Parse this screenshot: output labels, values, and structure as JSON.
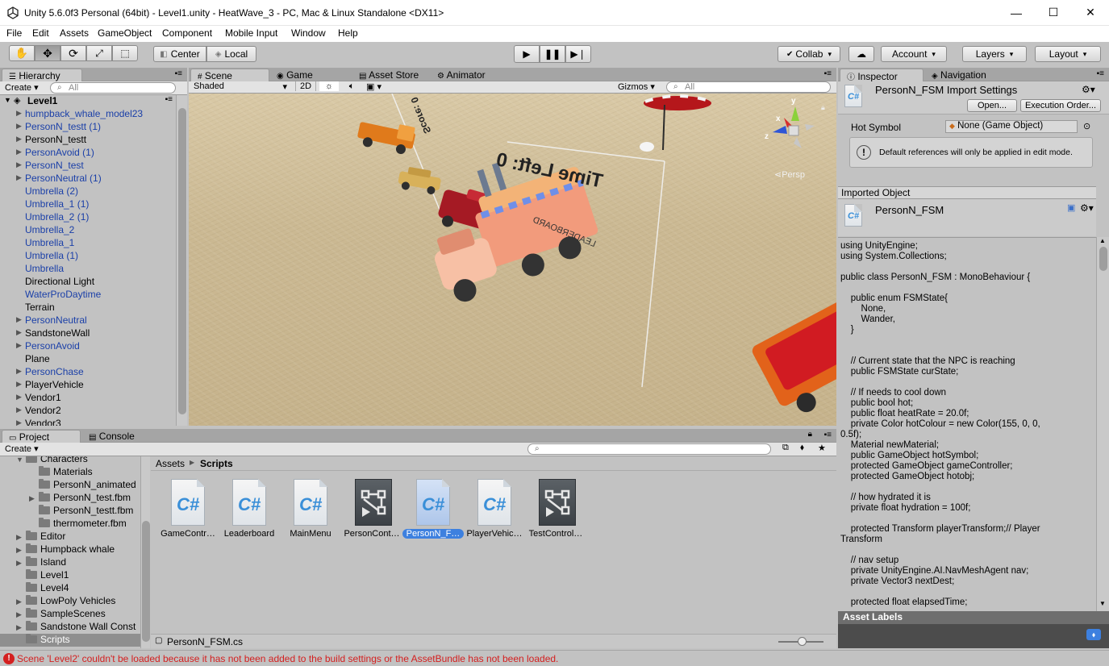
{
  "window": {
    "title": "Unity 5.6.0f3 Personal (64bit) - Level1.unity - HeatWave_3 - PC, Mac & Linux Standalone <DX11>",
    "minimize": "—",
    "maximize": "☐",
    "close": "✕"
  },
  "menu": [
    "File",
    "Edit",
    "Assets",
    "GameObject",
    "Component",
    "Mobile Input",
    "Window",
    "Help"
  ],
  "toolbar": {
    "pivot": "Center",
    "space": "Local",
    "collab": "Collab",
    "account": "Account",
    "layers": "Layers",
    "layout": "Layout"
  },
  "hierarchy": {
    "tab": "Hierarchy",
    "create": "Create",
    "search_placeholder": "All",
    "scene": "Level1",
    "items": [
      {
        "label": "humpback_whale_model23",
        "blue": true,
        "arrow": true
      },
      {
        "label": "PersonN_testt (1)",
        "blue": true,
        "arrow": true
      },
      {
        "label": "PersonN_testt",
        "blue": false,
        "arrow": true
      },
      {
        "label": "PersonAvoid (1)",
        "blue": true,
        "arrow": true
      },
      {
        "label": "PersonN_test",
        "blue": true,
        "arrow": true
      },
      {
        "label": "PersonNeutral (1)",
        "blue": true,
        "arrow": true
      },
      {
        "label": "Umbrella (2)",
        "blue": true,
        "arrow": false
      },
      {
        "label": "Umbrella_1 (1)",
        "blue": true,
        "arrow": false
      },
      {
        "label": "Umbrella_2 (1)",
        "blue": true,
        "arrow": false
      },
      {
        "label": "Umbrella_2",
        "blue": true,
        "arrow": false
      },
      {
        "label": "Umbrella_1",
        "blue": true,
        "arrow": false
      },
      {
        "label": "Umbrella (1)",
        "blue": true,
        "arrow": false
      },
      {
        "label": "Umbrella",
        "blue": true,
        "arrow": false
      },
      {
        "label": "Directional Light",
        "blue": false,
        "arrow": false
      },
      {
        "label": "WaterProDaytime",
        "blue": true,
        "arrow": false
      },
      {
        "label": "Terrain",
        "blue": false,
        "arrow": false
      },
      {
        "label": "PersonNeutral",
        "blue": true,
        "arrow": true
      },
      {
        "label": "SandstoneWall",
        "blue": false,
        "arrow": true
      },
      {
        "label": "PersonAvoid",
        "blue": true,
        "arrow": true
      },
      {
        "label": "Plane",
        "blue": false,
        "arrow": false
      },
      {
        "label": "PersonChase",
        "blue": true,
        "arrow": true
      },
      {
        "label": "PlayerVehicle",
        "blue": false,
        "arrow": true
      },
      {
        "label": "Vendor1",
        "blue": false,
        "arrow": true
      },
      {
        "label": "Vendor2",
        "blue": false,
        "arrow": true
      },
      {
        "label": "Vendor3",
        "blue": false,
        "arrow": true
      }
    ]
  },
  "scene": {
    "tabs": {
      "scene": "Scene",
      "game": "Game",
      "asset_store": "Asset Store",
      "animator": "Animator"
    },
    "shading": "Shaded",
    "mode_2d": "2D",
    "gizmos": "Gizmos",
    "search_placeholder": "All",
    "persp": "Persp",
    "world_text": {
      "time_left": "Time Left: 0",
      "score": "Score: 0",
      "leaderboard": "LEADERBOARD"
    },
    "axis": {
      "x": "x",
      "y": "y",
      "z": "z"
    }
  },
  "inspector": {
    "tabs": {
      "inspector": "Inspector",
      "navigation": "Navigation"
    },
    "title": "PersonN_FSM Import Settings",
    "open": "Open...",
    "execution_order": "Execution Order...",
    "hot_symbol_label": "Hot Symbol",
    "hot_symbol_value": "None (Game Object)",
    "info": "Default references will only be applied in edit mode.",
    "imported_object_header": "Imported Object",
    "imported_name": "PersonN_FSM",
    "code": "using UnityEngine;\nusing System.Collections;\n\npublic class PersonN_FSM : MonoBehaviour {\n\n    public enum FSMState{\n        None,\n        Wander,\n    }\n\n\n    // Current state that the NPC is reaching\n    public FSMState curState;\n\n    // If needs to cool down\n    public bool hot;\n    public float heatRate = 20.0f;\n    private Color hotColour = new Color(155, 0, 0,\n0.5f);\n    Material newMaterial;\n    public GameObject hotSymbol;\n    protected GameObject gameController;\n    protected GameObject hotobj;\n\n    // how hydrated it is\n    private float hydration = 100f;\n\n    protected Transform playerTransform;// Player\nTransform\n\n    // nav setup\n    private UnityEngine.AI.NavMeshAgent nav;\n    private Vector3 nextDest;\n\n    protected float elapsedTime;",
    "asset_labels": "Asset Labels"
  },
  "project": {
    "tabs": {
      "project": "Project",
      "console": "Console"
    },
    "create": "Create",
    "breadcrumb": {
      "root": "Assets",
      "current": "Scripts"
    },
    "tree": [
      {
        "label": "Characters",
        "indent": 0,
        "arrow": "▼"
      },
      {
        "label": "Materials",
        "indent": 1,
        "arrow": ""
      },
      {
        "label": "PersonN_animated",
        "indent": 1,
        "arrow": ""
      },
      {
        "label": "PersonN_test.fbm",
        "indent": 1,
        "arrow": "▶"
      },
      {
        "label": "PersonN_testt.fbm",
        "indent": 1,
        "arrow": ""
      },
      {
        "label": "thermometer.fbm",
        "indent": 1,
        "arrow": ""
      },
      {
        "label": "Editor",
        "indent": 0,
        "arrow": "▶"
      },
      {
        "label": "Humpback whale",
        "indent": 0,
        "arrow": "▶"
      },
      {
        "label": "Island",
        "indent": 0,
        "arrow": "▶"
      },
      {
        "label": "Level1",
        "indent": 0,
        "arrow": ""
      },
      {
        "label": "Level4",
        "indent": 0,
        "arrow": ""
      },
      {
        "label": "LowPoly Vehicles",
        "indent": 0,
        "arrow": "▶"
      },
      {
        "label": "SampleScenes",
        "indent": 0,
        "arrow": "▶"
      },
      {
        "label": "Sandstone Wall Const",
        "indent": 0,
        "arrow": "▶"
      },
      {
        "label": "Scripts",
        "indent": 0,
        "arrow": ""
      }
    ],
    "assets": [
      {
        "name": "GameContr…",
        "kind": "cs",
        "selected": false
      },
      {
        "name": "Leaderboard",
        "kind": "cs",
        "selected": false
      },
      {
        "name": "MainMenu",
        "kind": "cs",
        "selected": false
      },
      {
        "name": "PersonCont…",
        "kind": "controller",
        "selected": false
      },
      {
        "name": "PersonN_F…",
        "kind": "cs",
        "selected": true
      },
      {
        "name": "PlayerVehic…",
        "kind": "cs",
        "selected": false
      },
      {
        "name": "TestControl…",
        "kind": "controller",
        "selected": false
      }
    ],
    "selected_file": "PersonN_FSM.cs"
  },
  "status": {
    "message": "Scene 'Level2' couldn't be loaded because it has not been added to the build settings or the AssetBundle has not been loaded."
  },
  "colors": {
    "accent": "#3d80df",
    "error": "#d42020",
    "hierarchy_blue": "#1a3fa8"
  }
}
